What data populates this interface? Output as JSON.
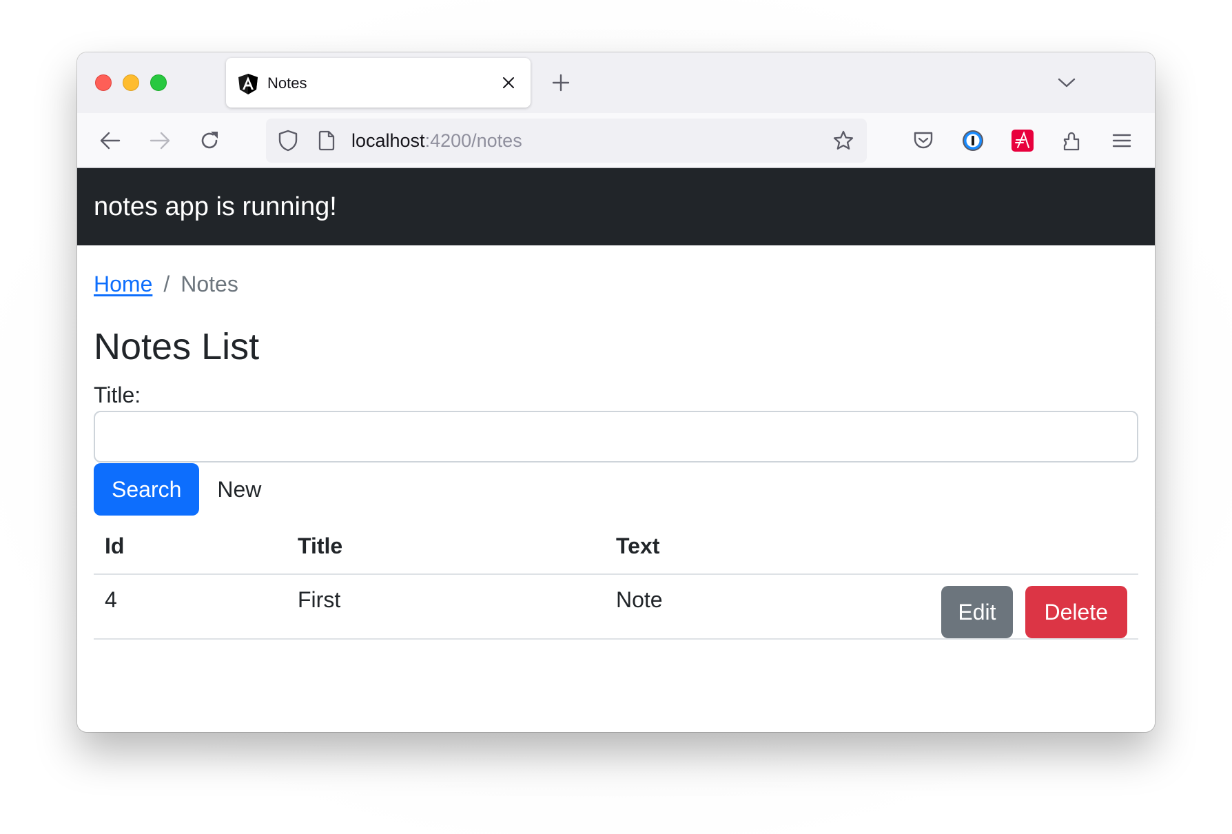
{
  "browser": {
    "tab": {
      "title": "Notes",
      "favicon": "angular-icon"
    },
    "url": {
      "host": "localhost",
      "rest": ":4200/notes"
    },
    "toolbar_icons": [
      "back-icon",
      "forward-icon",
      "reload-icon",
      "shield-icon",
      "page-icon",
      "bookmark-star-icon",
      "pocket-icon",
      "1password-icon",
      "extension-a-icon",
      "extensions-puzzle-icon",
      "menu-hamburger-icon"
    ]
  },
  "app": {
    "header_title": "notes app is running!",
    "breadcrumb": {
      "home_label": "Home",
      "separator": "/",
      "current": "Notes"
    },
    "page_title": "Notes List",
    "search_form": {
      "title_label": "Title:",
      "title_value": "",
      "title_placeholder": "",
      "search_label": "Search",
      "new_label": "New"
    },
    "table": {
      "columns": [
        "Id",
        "Title",
        "Text",
        ""
      ],
      "rows": [
        {
          "id": "4",
          "title": "First",
          "text": "Note",
          "edit_label": "Edit",
          "delete_label": "Delete"
        }
      ]
    }
  },
  "colors": {
    "header_bg": "#212529",
    "primary": "#0d6efd",
    "secondary": "#6c757d",
    "danger": "#dc3545",
    "link": "#0d6efd"
  }
}
